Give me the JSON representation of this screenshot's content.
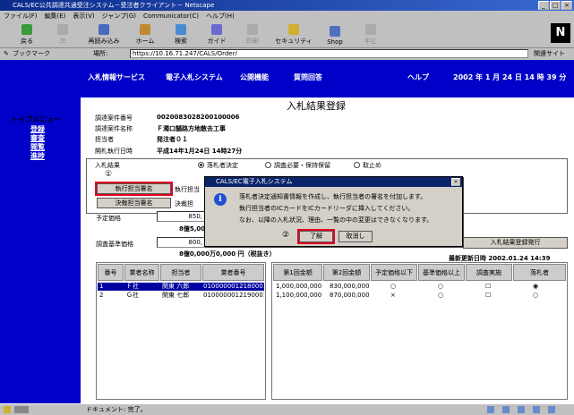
{
  "window": {
    "title": "CALS/EC公共調達共通受注システム－受注者クライアント－ Netscape",
    "min": "_",
    "max": "□",
    "close": "×"
  },
  "menu": [
    "ファイル(F)",
    "編集(E)",
    "表示(V)",
    "ジャンプ(G)",
    "Communicator(C)",
    "ヘルプ(H)"
  ],
  "toolbar": [
    "戻る",
    "次",
    "再読み込み",
    "ホーム",
    "検索",
    "ガイド",
    "印刷",
    "セキュリティ",
    "Shop",
    "中止"
  ],
  "location": {
    "bookmark": "ブックマーク",
    "label": "場所:",
    "url": "https://10.16.71.247/CALS/Order/",
    "related": "関連サイト"
  },
  "sidebar": {
    "title": "トップメニュー",
    "items": [
      "登録",
      "審査",
      "閲覧",
      "進捗"
    ]
  },
  "nav": {
    "items": [
      "入札情報サービス",
      "電子入札システム",
      "公開機能",
      "質問回答",
      "ヘルプ"
    ],
    "date": "2002 年 1 月 24 日 14 時 39 分"
  },
  "page": {
    "title": "入札結果登録"
  },
  "info": [
    {
      "label": "調達案件番号",
      "value": "0020083028200100006"
    },
    {
      "label": "調達案件名称",
      "value": "Ｆ濁口舗路方地散去工事"
    },
    {
      "label": "担当者",
      "value": "発注者０１"
    },
    {
      "label": "開札執行日時",
      "value": "平成14年1月24日 14時27分"
    }
  ],
  "result": {
    "label": "入札結果",
    "options": [
      "落札者決定",
      "調査必要・保持保留",
      "取止め"
    ],
    "marker1": "①",
    "exec_btn": "執行担当署名",
    "exec_label": "執行担当",
    "decide_btn": "決裁担当署名",
    "decide_label": "決裁担"
  },
  "price": {
    "yotei_label": "予定価格",
    "yotei_value": "850,",
    "yotei_note": "8億5,000",
    "kijun_label": "調査基準価格",
    "kijun_value": "800,",
    "kijun_note": "8億0,000万0,000 円（税抜き）"
  },
  "issue_btn": "入札結果登録発行",
  "last_update": "最新更新日時 2002.01.24 14:39",
  "table": {
    "headers": [
      "番号",
      "業者名称",
      "担当者",
      "業者番号",
      "第1回金額",
      "第2回金額",
      "予定価格以下",
      "基準価格以上",
      "調査実施",
      "落札者"
    ],
    "rows": [
      {
        "no": "1",
        "name": "Ｆ社",
        "person": "関東 六郎",
        "code": "010000001218000120",
        "amt1": "1,000,000,000",
        "amt2": "830,000,000",
        "yotei": "○",
        "kijun": "○",
        "chosa": "☐",
        "rakusatsu": "◉"
      },
      {
        "no": "2",
        "name": "Ｇ社",
        "person": "関東 七郎",
        "code": "010000001219000120",
        "amt1": "1,100,000,000",
        "amt2": "870,000,000",
        "yotei": "×",
        "kijun": "○",
        "chosa": "☐",
        "rakusatsu": "○"
      }
    ]
  },
  "dialog": {
    "title": "CALS/EC電子入札システム",
    "close": "×",
    "lines": [
      "落札者決定通知書情報を作成し、執行担当者の署名を付加します。",
      "執行担当者のICカードをICカードリーダに挿入してください。",
      "なお、以降の入札状況、理由、一覧の中の変更はできなくなります。"
    ],
    "marker2": "②",
    "ok": "了解",
    "cancel": "取消し"
  },
  "status": {
    "text": "ドキュメント: 完了。"
  }
}
